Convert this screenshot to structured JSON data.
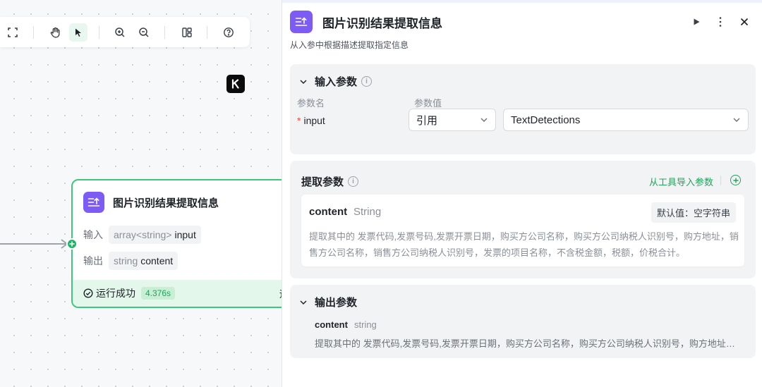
{
  "canvas": {
    "k_badge": "K",
    "node": {
      "title": "图片识别结果提取信息",
      "input_label": "输入",
      "input_type": "array<string>",
      "input_name": "input",
      "output_label": "输出",
      "output_type": "string",
      "output_name": "content",
      "status": "运行成功",
      "duration": "4.376s",
      "trailing": "运"
    }
  },
  "panel": {
    "title": "图片识别结果提取信息",
    "description": "从入参中根据描述提取指定信息",
    "input_section": {
      "title": "输入参数",
      "col_name": "参数名",
      "col_value": "参数值",
      "param_name": "input",
      "source_mode": "引用",
      "source_value": "TextDetections"
    },
    "extract_section": {
      "title": "提取参数",
      "import_link": "从工具导入参数",
      "field_name": "content",
      "field_type": "String",
      "default_value": "默认值：空字符串",
      "field_desc": "提取其中的 发票代码,发票号码,发票开票日期，购买方公司名称，购买方公司纳税人识别号，购方地址，销售方公司名称，销售方公司纳税人识别号，发票的项目名称，不含税金额，税额，价税合计。"
    },
    "output_section": {
      "title": "输出参数",
      "field_name": "content",
      "field_type": "string",
      "field_desc": "提取其中的 发票代码,发票号码,发票开票日期，购买方公司名称，购买方公司纳税人识别号，购方地址，销售方公司名称，销售方公司纳税人识别号，发票的项目名称，不含税金额，税额，价税合计。"
    }
  },
  "colors": {
    "accent": "#21b36a",
    "brand_icon": "#7c5cf5",
    "success_bg": "#e3f7ea"
  }
}
